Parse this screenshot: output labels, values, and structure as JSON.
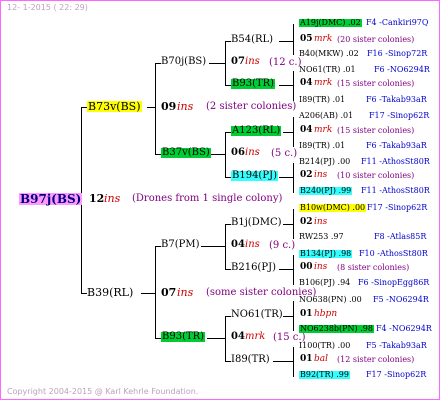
{
  "header": "12-  1-2015 ( 22: 29)",
  "footer": "Copyright 2004-2015 @ Karl Kehrle Foundation.",
  "root": {
    "name": "B97j(BS)",
    "gen": "12",
    "ins": "ins",
    "note": "(Drones from 1 single colony)"
  },
  "upper": {
    "name": "B73v(BS)",
    "gen": "09",
    "ins": "ins",
    "note": "(2 sister colonies)",
    "a": {
      "name": "B70j(BS)",
      "gen": "07",
      "ins": "ins",
      "note": "(12 c.)",
      "p1": {
        "name": "B54(RL)",
        "gen": "05",
        "mrk": "mrk",
        "note": "(20 sister colonies)",
        "x1": {
          "name": "A19j(DMC) .02",
          "trail": "F4 -Cankiri97Q"
        },
        "x2": {
          "name": "B40(MKW) .02",
          "trail": "F16 -Sinop72R"
        }
      },
      "p2": {
        "name": "B93(TR)",
        "gen": "04",
        "mrk": "mrk",
        "note": "(15 sister colonies)",
        "x1": {
          "name": "NO61(TR) .01",
          "trail": "F6 -NO6294R"
        },
        "x2": {
          "name": "I89(TR) .01",
          "trail": "F6 -Takab93aR"
        }
      }
    },
    "b": {
      "name": "B37v(BS)",
      "gen": "06",
      "ins": "ins",
      "note": "(5 c.)",
      "p1": {
        "name": "A123(RL)",
        "gen": "04",
        "mrk": "mrk",
        "note": "(15 sister colonies)",
        "x1": {
          "name": "A206(AB) .01",
          "trail": "F17 -Sinop62R"
        },
        "x2": {
          "name": "I89(TR) .01",
          "trail": "F6 -Takab93aR"
        }
      },
      "p2": {
        "name": "B194(PJ)",
        "gen": "02",
        "ins": "ins",
        "note": "(10 sister colonies)",
        "x1": {
          "name": "B214(PJ) .00",
          "trail": "F11 -AthosSt80R"
        },
        "x2": {
          "name": "B240(PJ) .99",
          "trail": "F11 -AthosSt80R"
        }
      }
    }
  },
  "lower": {
    "name": "B39(RL)",
    "gen": "07",
    "ins": "ins",
    "note": "(some sister colonies)",
    "a": {
      "name": "B7(PM)",
      "gen": "04",
      "ins": "ins",
      "note": "(9 c.)",
      "p1": {
        "name": "B1j(DMC)",
        "gen": "02",
        "ins": "ins",
        "note": "",
        "x1": {
          "name": "B10w(DMC) .00",
          "trail": "F17 -Sinop62R"
        },
        "x2": {
          "name": "RW253 .97",
          "trail": "F8 -Atlas85R"
        }
      },
      "p2": {
        "name": "B216(PJ)",
        "gen": "00",
        "ins": "ins",
        "note": "(8 sister colonies)",
        "x1": {
          "name": "B134(PJ) .98",
          "trail": "F10 -AthosSt80R"
        },
        "x2": {
          "name": "B106(PJ) .94",
          "trail": "F6 -SinopEgg86R"
        }
      }
    },
    "b": {
      "name": "B93(TR)",
      "gen": "04",
      "mrk": "mrk",
      "note": "(15 c.)",
      "p1": {
        "name": "NO61(TR)",
        "gen": "01",
        "ins": "hbpn",
        "note": "",
        "x1": {
          "name": "NO638(PN) .00",
          "trail": "F5 -NO6294R"
        },
        "x2": {
          "name": "NO6238b(PN) .98",
          "trail": "F4 -NO6294R"
        }
      },
      "p2": {
        "name": "I89(TR)",
        "gen": "01",
        "ins": "bal",
        "note": "(12 sister colonies)",
        "x1": {
          "name": "I100(TR) .00",
          "trail": "F5 -Takab93aR"
        },
        "x2": {
          "name": "B92(TR) .99",
          "trail": "F17 -Sinop62R"
        }
      }
    }
  }
}
